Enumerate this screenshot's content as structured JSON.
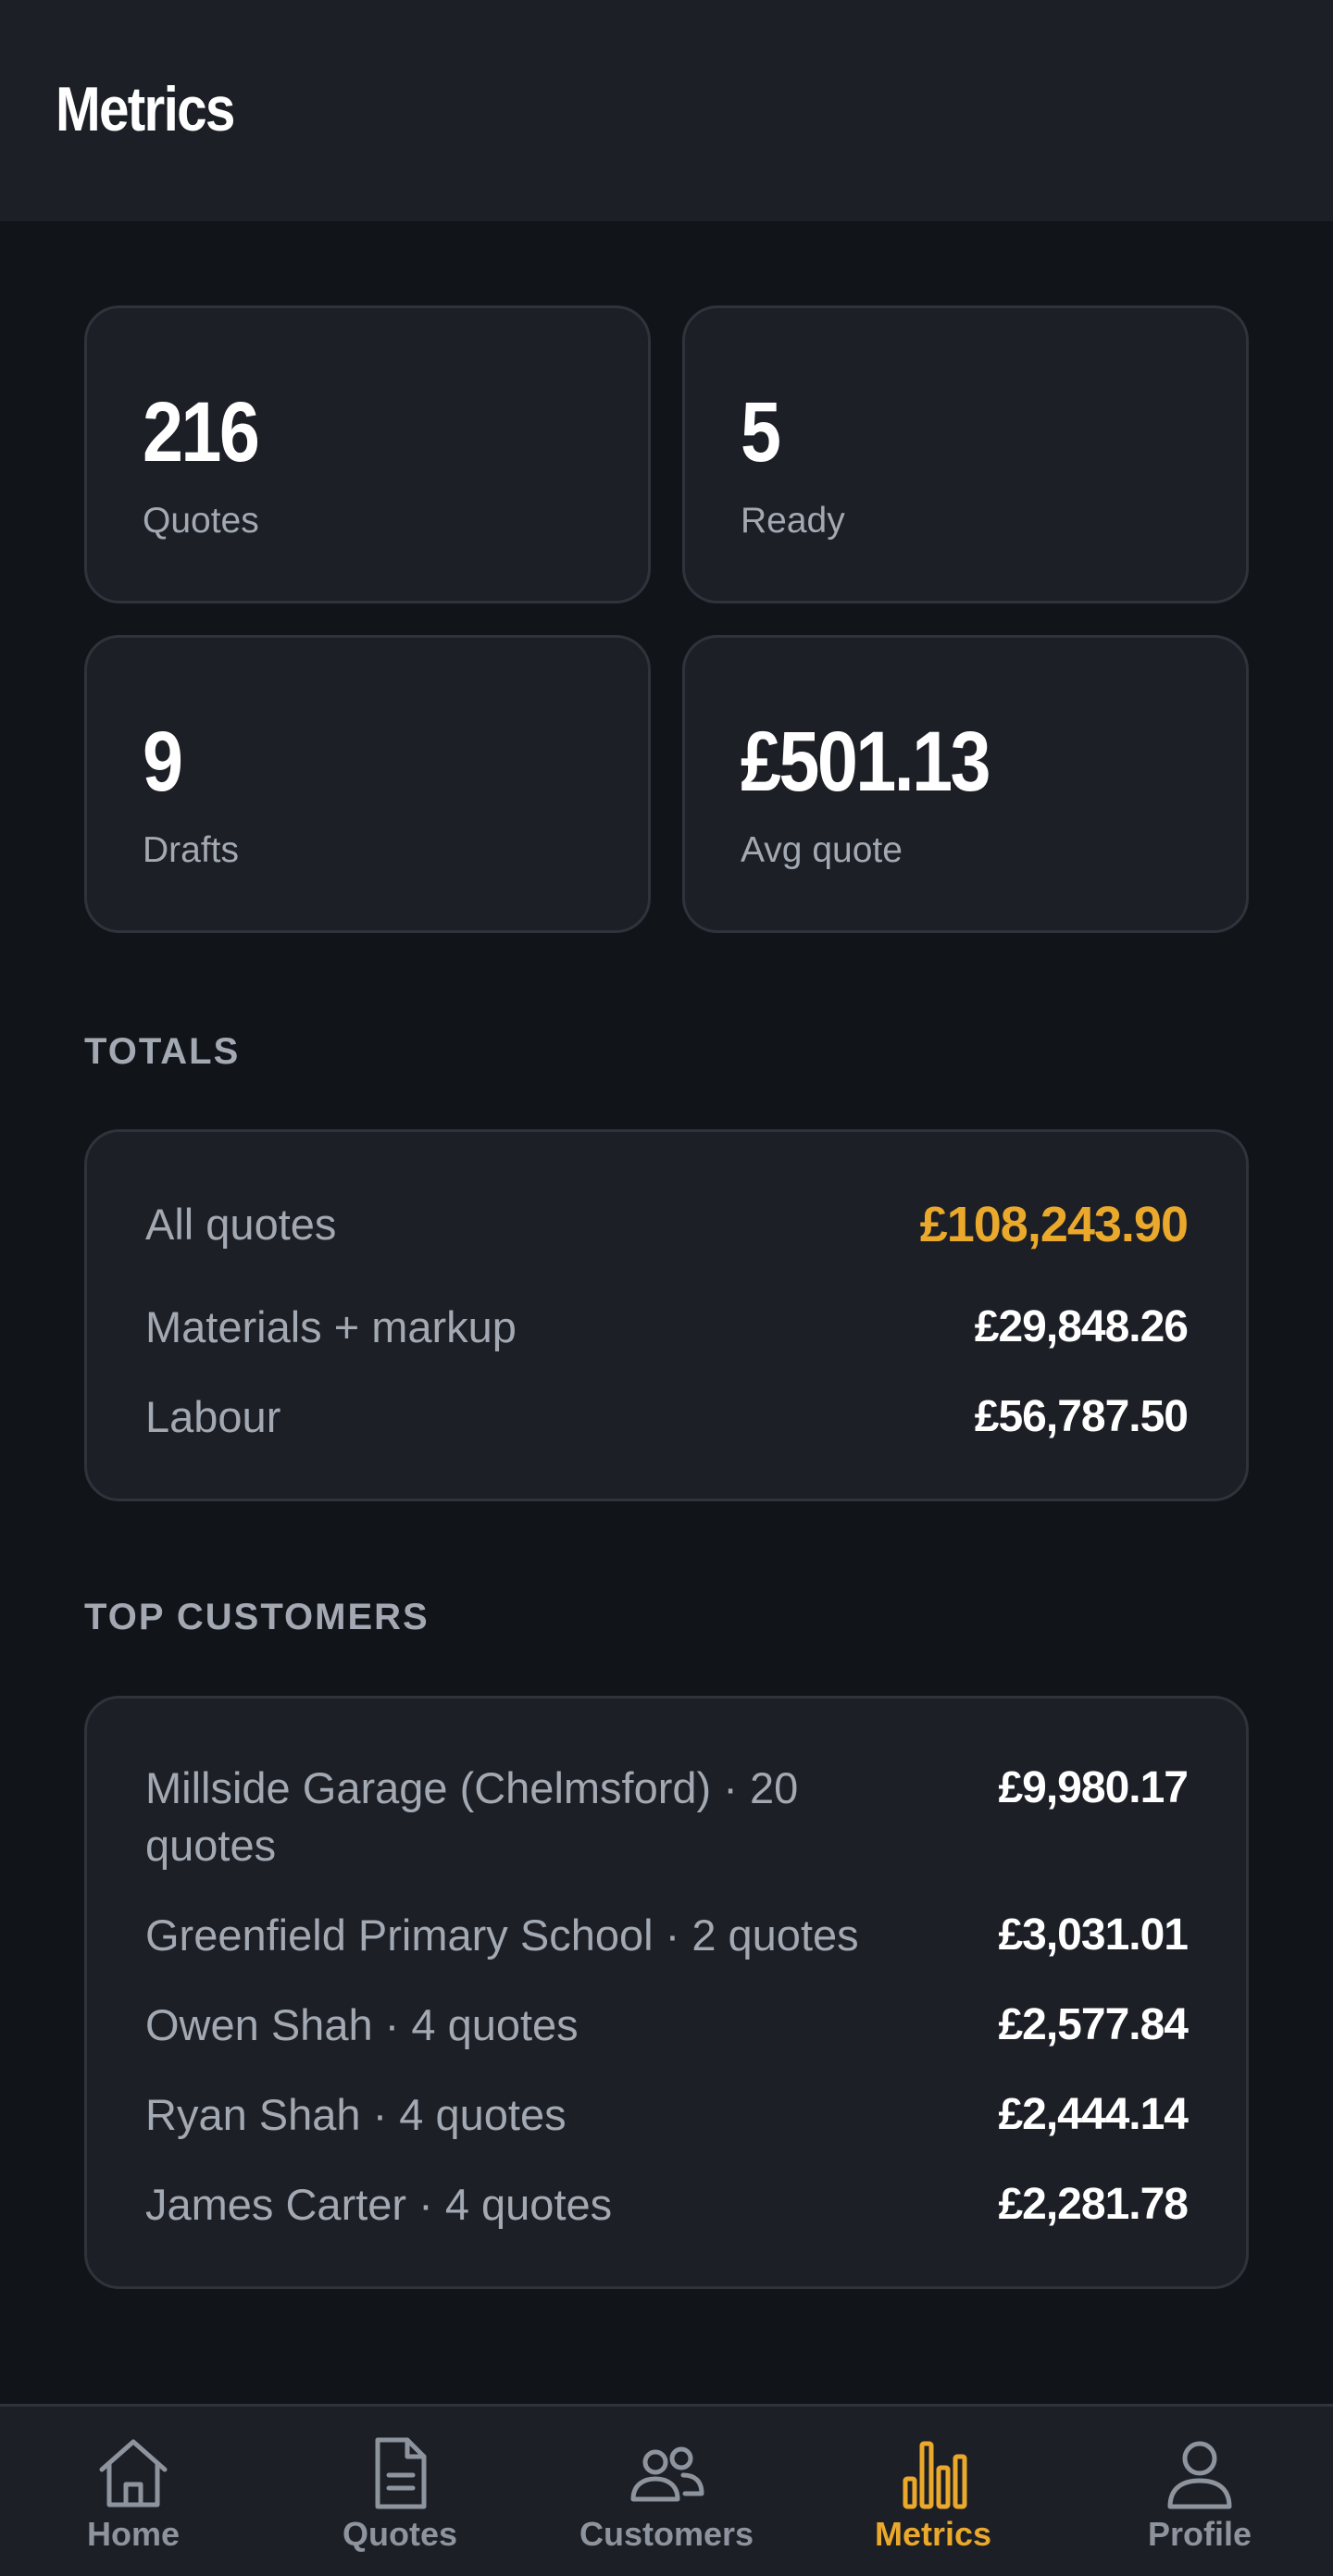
{
  "header": {
    "title": "Metrics"
  },
  "stats": [
    {
      "value": "216",
      "label": "Quotes"
    },
    {
      "value": "5",
      "label": "Ready"
    },
    {
      "value": "9",
      "label": "Drafts"
    },
    {
      "value": "£501.13",
      "label": "Avg quote"
    }
  ],
  "totals": {
    "title": "TOTALS",
    "rows": [
      {
        "label": "All quotes",
        "value": "£108,243.90"
      },
      {
        "label": "Materials + markup",
        "value": "£29,848.26"
      },
      {
        "label": "Labour",
        "value": "£56,787.50"
      }
    ]
  },
  "top_customers": {
    "title": "TOP CUSTOMERS",
    "rows": [
      {
        "label": "Millside Garage (Chelmsford) · 20 quotes",
        "value": "£9,980.17"
      },
      {
        "label": "Greenfield Primary School · 2 quotes",
        "value": "£3,031.01"
      },
      {
        "label": "Owen Shah · 4 quotes",
        "value": "£2,577.84"
      },
      {
        "label": "Ryan Shah · 4 quotes",
        "value": "£2,444.14"
      },
      {
        "label": "James Carter · 4 quotes",
        "value": "£2,281.78"
      }
    ]
  },
  "nav": {
    "active": "Metrics",
    "items": [
      {
        "label": "Home",
        "icon": "home-icon"
      },
      {
        "label": "Quotes",
        "icon": "document-icon"
      },
      {
        "label": "Customers",
        "icon": "users-icon"
      },
      {
        "label": "Metrics",
        "icon": "bar-chart-icon"
      },
      {
        "label": "Profile",
        "icon": "user-icon"
      }
    ]
  },
  "colors": {
    "background": "#111418",
    "surface": "#1c1f26",
    "border": "#2e333c",
    "accent": "#eba92c",
    "muted_text": "#a3a9b3"
  }
}
